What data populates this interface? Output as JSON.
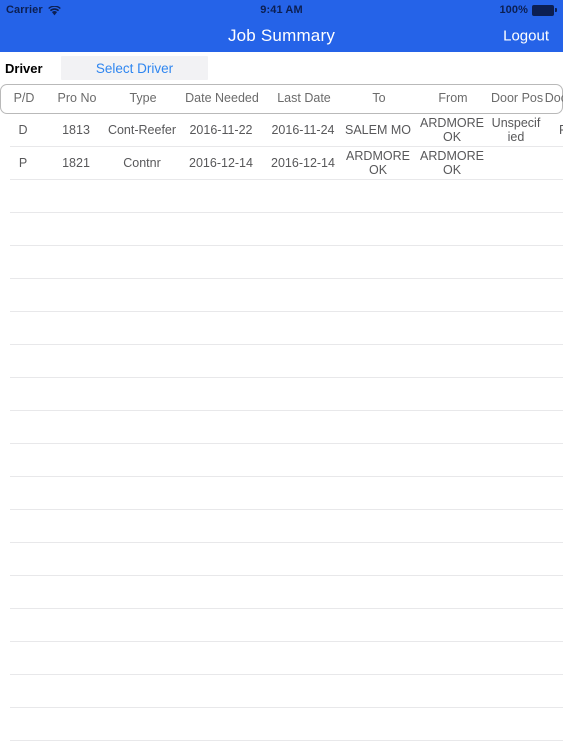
{
  "status_bar": {
    "carrier": "Carrier",
    "wifi_icon": "wifi-icon",
    "time": "9:41 AM",
    "battery_percent": "100%",
    "battery_icon": "battery-full-icon"
  },
  "nav_bar": {
    "title": "Job Summary",
    "logout_label": "Logout",
    "background_color": "#2563e8",
    "text_color": "#ffffff"
  },
  "driver_bar": {
    "label": "Driver",
    "select_driver_label": "Select Driver",
    "select_driver_color": "#2f86f0",
    "select_driver_background": "#f2f2f4"
  },
  "table": {
    "columns": [
      {
        "key": "pd",
        "label": "P/D"
      },
      {
        "key": "pro_no",
        "label": "Pro No"
      },
      {
        "key": "type",
        "label": "Type"
      },
      {
        "key": "date_needed",
        "label": "Date Needed"
      },
      {
        "key": "last_date",
        "label": "Last Date"
      },
      {
        "key": "to",
        "label": "To"
      },
      {
        "key": "from",
        "label": "From"
      },
      {
        "key": "door_pos",
        "label": "Door Pos"
      },
      {
        "key": "door_type",
        "label": "Door Type"
      }
    ],
    "rows": [
      {
        "pd": "D",
        "pro_no": "1813",
        "type": "Cont-Reefer",
        "date_needed": "2016-11-22",
        "last_date": "2016-11-24",
        "to": "SALEM MO",
        "from": "ARDMORE OK",
        "door_pos": "Unspecified",
        "door_type": "Rear"
      },
      {
        "pd": "P",
        "pro_no": "1821",
        "type": "Contnr",
        "date_needed": "2016-12-14",
        "last_date": "2016-12-14",
        "to": "ARDMORE OK",
        "from": "ARDMORE OK",
        "door_pos": "",
        "door_type": ""
      }
    ],
    "empty_row_count": 17,
    "separator_color": "#e8e8ea",
    "header_border_color": "#b9b9b9",
    "header_text_color": "#6b6b6b",
    "cell_text_color": "#58585a"
  }
}
